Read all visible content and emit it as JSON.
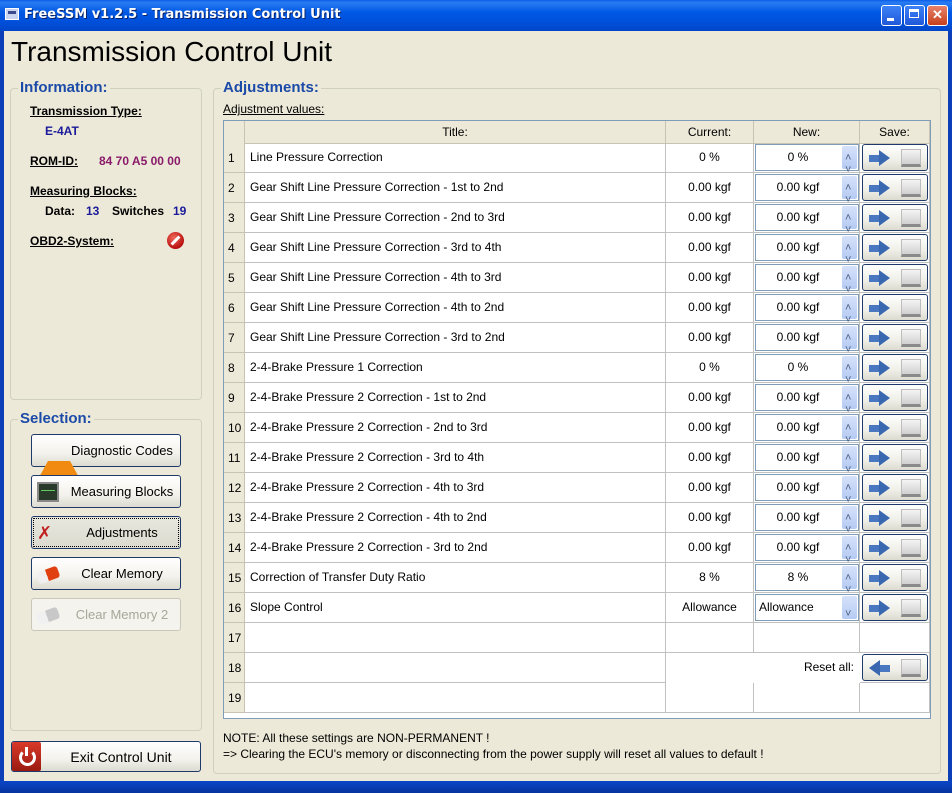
{
  "window": {
    "title": "FreeSSM v1.2.5 - Transmission Control Unit",
    "controls": [
      "minimize",
      "maximize",
      "close"
    ]
  },
  "page_title": "Transmission Control Unit",
  "information": {
    "heading": "Information:",
    "transmission_type_label": "Transmission Type:",
    "transmission_type_value": "E-4AT",
    "rom_id_label": "ROM-ID:",
    "rom_id_value": "84 70 A5 00 00",
    "measuring_blocks_label": "Measuring Blocks:",
    "data_label": "Data:",
    "data_value": "13",
    "switches_label": "Switches",
    "switches_value": "19",
    "obd2_label": "OBD2-System:",
    "obd2_status_icon": "not-available-icon"
  },
  "selection": {
    "heading": "Selection:",
    "buttons": [
      {
        "label": "Diagnostic Codes",
        "icon": "warning-icon",
        "state": "normal"
      },
      {
        "label": "Measuring Blocks",
        "icon": "monitor-icon",
        "state": "normal"
      },
      {
        "label": "Adjustments",
        "icon": "tools-icon",
        "state": "active"
      },
      {
        "label": "Clear Memory",
        "icon": "eraser-icon",
        "state": "normal"
      },
      {
        "label": "Clear Memory 2",
        "icon": "eraser-icon",
        "state": "disabled"
      }
    ],
    "exit_label": "Exit Control Unit"
  },
  "adjustments": {
    "heading": "Adjustments:",
    "subheading": "Adjustment values:",
    "columns": [
      "Title:",
      "Current:",
      "New:",
      "Save:"
    ],
    "rows": [
      {
        "n": "1",
        "title": "Line Pressure Correction",
        "current": "0 %",
        "new": "0 %",
        "control": "spinbox"
      },
      {
        "n": "2",
        "title": "Gear Shift Line Pressure Correction - 1st to 2nd",
        "current": "0.00 kgf",
        "new": "0.00 kgf",
        "control": "spinbox"
      },
      {
        "n": "3",
        "title": "Gear Shift Line Pressure Correction - 2nd to 3rd",
        "current": "0.00 kgf",
        "new": "0.00 kgf",
        "control": "spinbox"
      },
      {
        "n": "4",
        "title": "Gear Shift Line Pressure Correction - 3rd to 4th",
        "current": "0.00 kgf",
        "new": "0.00 kgf",
        "control": "spinbox"
      },
      {
        "n": "5",
        "title": "Gear Shift Line Pressure Correction - 4th to 3rd",
        "current": "0.00 kgf",
        "new": "0.00 kgf",
        "control": "spinbox"
      },
      {
        "n": "6",
        "title": "Gear Shift Line Pressure Correction - 4th to 2nd",
        "current": "0.00 kgf",
        "new": "0.00 kgf",
        "control": "spinbox"
      },
      {
        "n": "7",
        "title": "Gear Shift Line Pressure Correction - 3rd to 2nd",
        "current": "0.00 kgf",
        "new": "0.00 kgf",
        "control": "spinbox"
      },
      {
        "n": "8",
        "title": "2-4-Brake Pressure 1 Correction",
        "current": "0 %",
        "new": "0 %",
        "control": "spinbox"
      },
      {
        "n": "9",
        "title": "2-4-Brake Pressure 2 Correction - 1st to 2nd",
        "current": "0.00 kgf",
        "new": "0.00 kgf",
        "control": "spinbox"
      },
      {
        "n": "10",
        "title": "2-4-Brake Pressure 2 Correction - 2nd to 3rd",
        "current": "0.00 kgf",
        "new": "0.00 kgf",
        "control": "spinbox"
      },
      {
        "n": "11",
        "title": "2-4-Brake Pressure 2 Correction - 3rd to 4th",
        "current": "0.00 kgf",
        "new": "0.00 kgf",
        "control": "spinbox"
      },
      {
        "n": "12",
        "title": "2-4-Brake Pressure 2 Correction - 4th to 3rd",
        "current": "0.00 kgf",
        "new": "0.00 kgf",
        "control": "spinbox"
      },
      {
        "n": "13",
        "title": "2-4-Brake Pressure 2 Correction - 4th to 2nd",
        "current": "0.00 kgf",
        "new": "0.00 kgf",
        "control": "spinbox"
      },
      {
        "n": "14",
        "title": "2-4-Brake Pressure 2 Correction - 3rd to 2nd",
        "current": "0.00 kgf",
        "new": "0.00 kgf",
        "control": "spinbox"
      },
      {
        "n": "15",
        "title": "Correction of Transfer Duty Ratio",
        "current": "8 %",
        "new": "8 %",
        "control": "spinbox"
      },
      {
        "n": "16",
        "title": "Slope Control",
        "current": "Allowance",
        "new": "Allowance",
        "control": "combobox"
      },
      {
        "n": "17",
        "title": "",
        "current": "",
        "new": "",
        "control": "none"
      },
      {
        "n": "18",
        "title": "",
        "current": "",
        "new": "",
        "control": "reset"
      },
      {
        "n": "19",
        "title": "",
        "current": "",
        "new": "",
        "control": "none"
      }
    ],
    "reset_all_label": "Reset all:",
    "note_line1": "NOTE:  All these settings are NON-PERMANENT !",
    "note_line2": "=> Clearing the ECU's memory or disconnecting from the power supply will reset all values to default !"
  }
}
